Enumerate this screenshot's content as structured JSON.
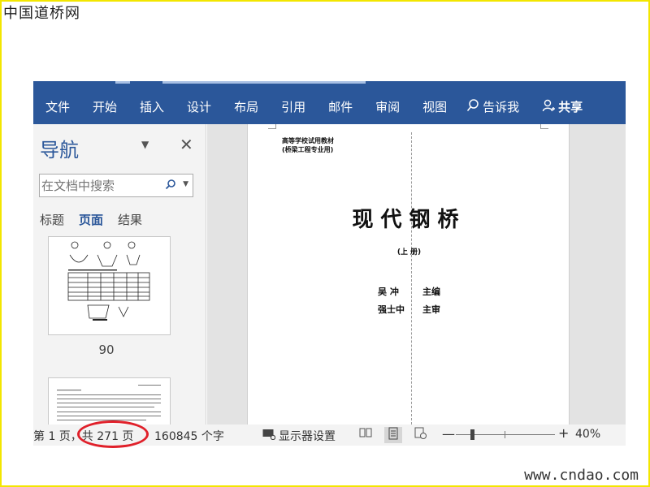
{
  "watermarks": {
    "top": "中国道桥网",
    "bottom": "www.cndao.com"
  },
  "ribbon": {
    "tabs": [
      "文件",
      "开始",
      "插入",
      "设计",
      "布局",
      "引用",
      "邮件",
      "审阅",
      "视图"
    ],
    "tell_me": "告诉我",
    "share": "共享",
    "color": "#2b579a"
  },
  "nav_pane": {
    "title": "导航",
    "search_placeholder": "在文档中搜索",
    "tabs": [
      "标题",
      "页面",
      "结果"
    ],
    "active_tab": "页面",
    "thumbnails": [
      {
        "label": "90"
      },
      {
        "label": ""
      }
    ]
  },
  "document": {
    "series_line1": "高等学校试用教材",
    "series_line2": "(桥梁工程专业用)",
    "title": "现代钢桥",
    "volume": "(上 册)",
    "authors": [
      {
        "name": "吴 冲",
        "role": "主编"
      },
      {
        "name": "强士中",
        "role": "主审"
      }
    ]
  },
  "statusbar": {
    "page_position": "第 1 页，共 271 页",
    "word_count": "160845 个字",
    "display_settings": "显示器设置",
    "zoom_level": "40%"
  },
  "annotation": {
    "highlight_color": "#e0202a",
    "frame_color": "#f3e600"
  }
}
